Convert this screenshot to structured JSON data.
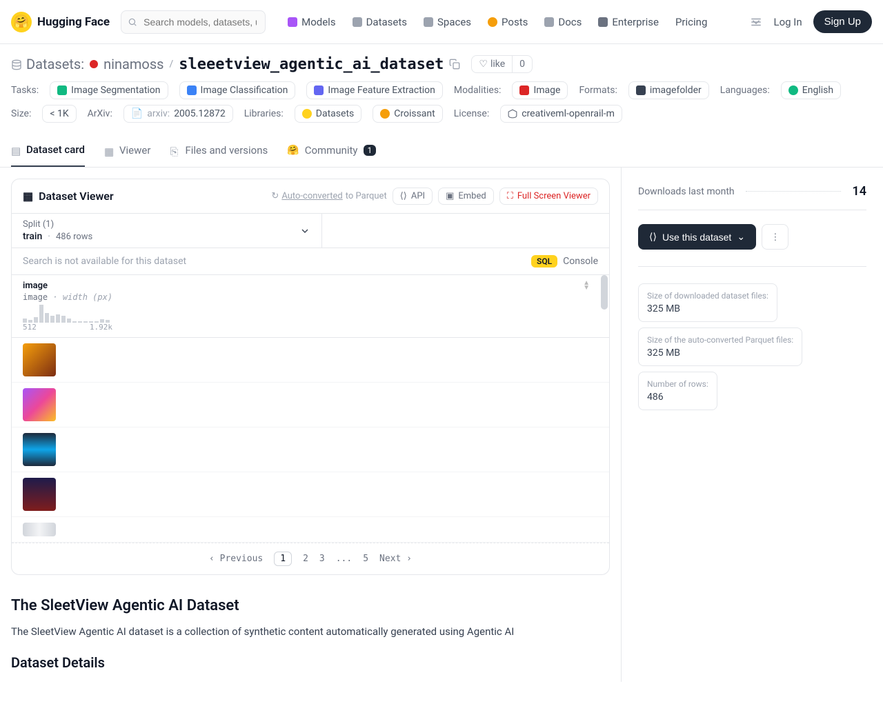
{
  "brand": "Hugging Face",
  "search_placeholder": "Search models, datasets, users...",
  "nav": {
    "models": "Models",
    "datasets": "Datasets",
    "spaces": "Spaces",
    "posts": "Posts",
    "docs": "Docs",
    "enterprise": "Enterprise",
    "pricing": "Pricing",
    "login": "Log In",
    "signup": "Sign Up"
  },
  "bc": {
    "section": "Datasets:",
    "owner": "ninamoss",
    "name": "sleeetview_agentic_ai_dataset",
    "like": "like",
    "like_count": "0"
  },
  "tags": {
    "tasks_label": "Tasks:",
    "task1": "Image Segmentation",
    "task2": "Image Classification",
    "task3": "Image Feature Extraction",
    "modalities_label": "Modalities:",
    "modalities": "Image",
    "formats_label": "Formats:",
    "formats": "imagefolder",
    "languages_label": "Languages:",
    "languages": "English",
    "size_label": "Size:",
    "size": "< 1K",
    "arxiv_label": "ArXiv:",
    "arxiv_prefix": "arxiv:",
    "arxiv": "2005.12872",
    "libs_label": "Libraries:",
    "lib1": "Datasets",
    "lib2": "Croissant",
    "license_label": "License:",
    "license": "creativeml-openrail-m"
  },
  "tabs": {
    "card": "Dataset card",
    "viewer": "Viewer",
    "files": "Files and versions",
    "community": "Community",
    "community_count": "1"
  },
  "viewer": {
    "title": "Dataset Viewer",
    "auto1": "Auto-converted",
    "auto2": " to Parquet",
    "api": "API",
    "embed": "Embed",
    "fullscreen": "Full Screen Viewer",
    "split_label": "Split (1)",
    "split_name": "train",
    "split_rows": "486 rows",
    "search_text": "Search is not available for this dataset",
    "sql": "SQL",
    "console": "Console",
    "col_name": "image",
    "col_type": "image",
    "col_sub": "width (px)",
    "hist_min": "512",
    "hist_max": "1.92k",
    "prev": "Previous",
    "next": "Next",
    "pages": [
      "1",
      "2",
      "3",
      "...",
      "5"
    ]
  },
  "prose": {
    "h2": "The SleetView Agentic AI Dataset",
    "p": "The SleetView Agentic AI dataset is a collection of synthetic content automatically generated using Agentic AI",
    "h3": "Dataset Details"
  },
  "right": {
    "downloads_label": "Downloads last month",
    "downloads": "14",
    "use": "Use this dataset",
    "stat1_label": "Size of downloaded dataset files:",
    "stat1_val": "325 MB",
    "stat2_label": "Size of the auto-converted Parquet files:",
    "stat2_val": "325 MB",
    "stat3_label": "Number of rows:",
    "stat3_val": "486"
  }
}
